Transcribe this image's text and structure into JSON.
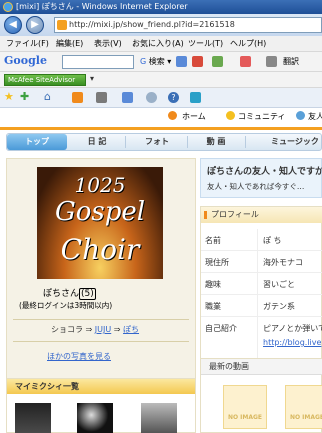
{
  "window": {
    "title": "[mixi] ぽちさん - Windows Internet Explorer"
  },
  "address": {
    "url": "http://mixi.jp/show_friend.pl?id=2161518"
  },
  "menu": [
    "ファイル(F)",
    "編集(E)",
    "表示(V)",
    "お気に入り(A)",
    "ツール(T)",
    "ヘルプ(H)"
  ],
  "google": {
    "logo": "Google",
    "search_label": "検索",
    "translate_label": "翻訳"
  },
  "mcafee": {
    "label": "McAfee SiteAdvisor"
  },
  "site_nav": {
    "home": "ホーム",
    "community": "コミュニティ",
    "friends": "友人"
  },
  "tabs": [
    {
      "label": "トップ",
      "active": true
    },
    {
      "label": "日 記",
      "active": false
    },
    {
      "label": "フォト",
      "active": false
    },
    {
      "label": "動 画",
      "active": false
    },
    {
      "label": "ミュージック",
      "active": false
    }
  ],
  "photo": {
    "line1": "1025",
    "line2": "Gospel",
    "line3": "Choir"
  },
  "user": {
    "name_prefix": "ぽちさん",
    "name_box": "(5)",
    "last_login": "(最終ログインは3時間以内)"
  },
  "chain": {
    "a": "ショコラ",
    "b": "JUJU",
    "c": "ぽち",
    "sep": "⇒"
  },
  "more_photos": "ほかの写真を見る",
  "mymixi": {
    "title": "マイミクシィ一覧"
  },
  "friend_intro": {
    "title": "ぽちさんの友人・知人ですか",
    "sub": "友人・知人であれば今すぐ…"
  },
  "profile": {
    "header": "プロフィール",
    "rows": [
      {
        "label": "名前",
        "value": "ぽ ち"
      },
      {
        "label": "現住所",
        "value": "海外モナコ"
      },
      {
        "label": "趣味",
        "value": "習いごと"
      },
      {
        "label": "職業",
        "value": "ガテン系"
      },
      {
        "label": "自己紹介",
        "value": "ピアノとか弾いて"
      }
    ],
    "link": "http://blog.live"
  },
  "videos": {
    "header": "最新の動画",
    "noimage": "NO IMAGE"
  }
}
